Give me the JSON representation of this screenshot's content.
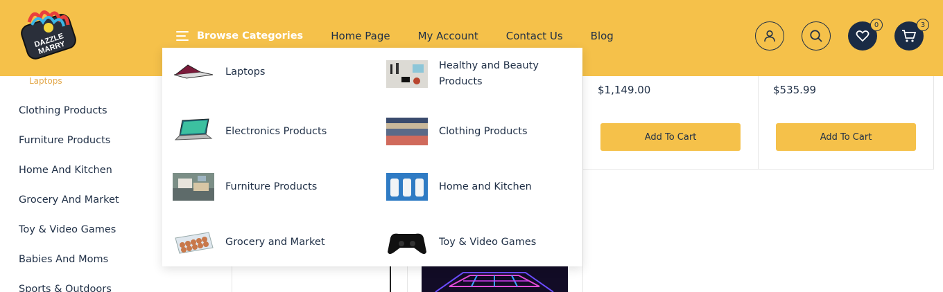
{
  "header": {
    "logo_text": [
      "DAZZLE",
      "MARRY"
    ],
    "browse_label": "Browse Categories",
    "nav": [
      "Home Page",
      "My Account",
      "Contact Us",
      "Blog"
    ],
    "wishlist_count": "0",
    "cart_count": "3"
  },
  "sidebar": {
    "active_sub": "Laptops",
    "items": [
      "Clothing Products",
      "Furniture Products",
      "Home And Kitchen",
      "Grocery And Market",
      "Toy & Video Games",
      "Babies And Moms",
      "Sports & Outdoors"
    ]
  },
  "products": [
    {
      "price": "$1,149.00",
      "button": "Add To Cart"
    },
    {
      "price": "$535.99",
      "button": "Add To Cart"
    }
  ],
  "mega_menu": {
    "left": [
      "Laptops",
      "Electronics Products",
      "Furniture Products",
      "Grocery and Market"
    ],
    "right": [
      "Healthy and Beauty Products",
      "Clothing Products",
      "Home and Kitchen",
      "Toy & Video Games"
    ]
  },
  "colors": {
    "brand_yellow": "#f5c14a",
    "navy": "#1a2b45",
    "text": "#1f2f46"
  },
  "icons": [
    "hamburger-icon",
    "user-icon",
    "search-icon",
    "heart-icon",
    "cart-icon"
  ]
}
